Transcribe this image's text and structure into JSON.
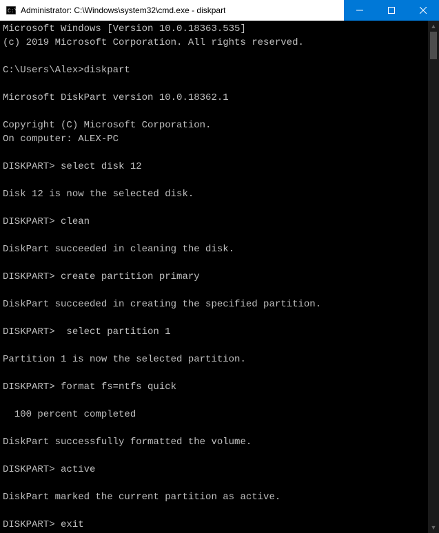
{
  "window": {
    "title": "Administrator: C:\\Windows\\system32\\cmd.exe - diskpart"
  },
  "console": {
    "lines": [
      "Microsoft Windows [Version 10.0.18363.535]",
      "(c) 2019 Microsoft Corporation. All rights reserved.",
      "",
      "C:\\Users\\Alex>diskpart",
      "",
      "Microsoft DiskPart version 10.0.18362.1",
      "",
      "Copyright (C) Microsoft Corporation.",
      "On computer: ALEX-PC",
      "",
      "DISKPART> select disk 12",
      "",
      "Disk 12 is now the selected disk.",
      "",
      "DISKPART> clean",
      "",
      "DiskPart succeeded in cleaning the disk.",
      "",
      "DISKPART> create partition primary",
      "",
      "DiskPart succeeded in creating the specified partition.",
      "",
      "DISKPART>  select partition 1",
      "",
      "Partition 1 is now the selected partition.",
      "",
      "DISKPART> format fs=ntfs quick",
      "",
      "  100 percent completed",
      "",
      "DiskPart successfully formatted the volume.",
      "",
      "DISKPART> active",
      "",
      "DiskPart marked the current partition as active.",
      "",
      "DISKPART> exit"
    ]
  }
}
